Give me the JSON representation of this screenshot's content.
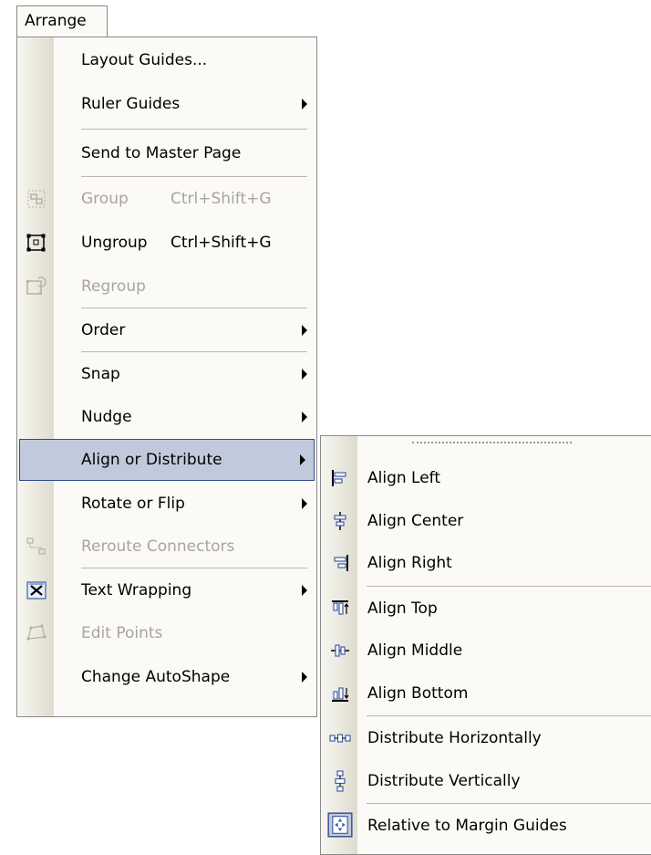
{
  "menu_title": "Arrange",
  "main_menu": {
    "items": [
      {
        "label": "Layout Guides...",
        "shortcut": "",
        "disabled": false,
        "submenu": false,
        "icon": ""
      },
      {
        "label": "Ruler Guides",
        "shortcut": "",
        "disabled": false,
        "submenu": true,
        "icon": ""
      },
      {
        "label": "Send to Master Page",
        "shortcut": "",
        "disabled": false,
        "submenu": false,
        "icon": ""
      },
      {
        "label": "Group",
        "shortcut": "Ctrl+Shift+G",
        "disabled": true,
        "submenu": false,
        "icon": "group-icon"
      },
      {
        "label": "Ungroup",
        "shortcut": "Ctrl+Shift+G",
        "disabled": false,
        "submenu": false,
        "icon": "ungroup-icon"
      },
      {
        "label": "Regroup",
        "shortcut": "",
        "disabled": true,
        "submenu": false,
        "icon": "regroup-icon"
      },
      {
        "label": "Order",
        "shortcut": "",
        "disabled": false,
        "submenu": true,
        "icon": ""
      },
      {
        "label": "Snap",
        "shortcut": "",
        "disabled": false,
        "submenu": true,
        "icon": ""
      },
      {
        "label": "Nudge",
        "shortcut": "",
        "disabled": false,
        "submenu": true,
        "icon": ""
      },
      {
        "label": "Align or Distribute",
        "shortcut": "",
        "disabled": false,
        "submenu": true,
        "icon": "",
        "highlighted": true
      },
      {
        "label": "Rotate or Flip",
        "shortcut": "",
        "disabled": false,
        "submenu": true,
        "icon": ""
      },
      {
        "label": "Reroute Connectors",
        "shortcut": "",
        "disabled": true,
        "submenu": false,
        "icon": "reroute-connectors-icon"
      },
      {
        "label": "Text Wrapping",
        "shortcut": "",
        "disabled": false,
        "submenu": true,
        "icon": "text-wrapping-icon"
      },
      {
        "label": "Edit Points",
        "shortcut": "",
        "disabled": true,
        "submenu": false,
        "icon": "edit-points-icon"
      },
      {
        "label": "Change AutoShape",
        "shortcut": "",
        "disabled": false,
        "submenu": true,
        "icon": ""
      }
    ]
  },
  "submenu": {
    "items": [
      {
        "label": "Align Left",
        "icon": "align-left-icon"
      },
      {
        "label": "Align Center",
        "icon": "align-center-icon"
      },
      {
        "label": "Align Right",
        "icon": "align-right-icon"
      },
      {
        "label": "Align Top",
        "icon": "align-top-icon"
      },
      {
        "label": "Align Middle",
        "icon": "align-middle-icon"
      },
      {
        "label": "Align Bottom",
        "icon": "align-bottom-icon"
      },
      {
        "label": "Distribute Horizontally",
        "icon": "distribute-horizontally-icon"
      },
      {
        "label": "Distribute Vertically",
        "icon": "distribute-vertically-icon"
      },
      {
        "label": "Relative to Margin Guides",
        "icon": "relative-to-margin-guides-icon"
      }
    ]
  },
  "colors": {
    "menu_background": "#fbfaf6",
    "highlight_fill": "#c1cadd",
    "highlight_border": "#2f4b8b",
    "disabled_text": "#a7a59d"
  }
}
